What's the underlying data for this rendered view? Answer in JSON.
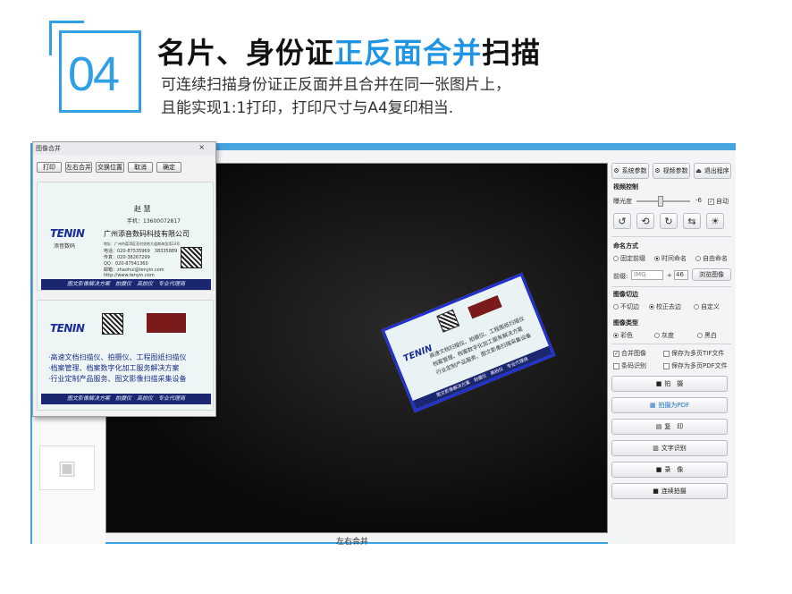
{
  "header": {
    "number": "04",
    "title_part1": "名片、身份证",
    "title_highlight": "正反面合并",
    "title_part2": "扫描",
    "subtitle_line1": "可连续扫描身份证正反面并且合并在同一张图片上，",
    "subtitle_line2": "且能实现1:1打印，打印尺寸与A4复印相当."
  },
  "popup": {
    "title": "图像合并",
    "close": "×",
    "buttons": [
      "打印",
      "左右合并",
      "交换位置",
      "取消",
      "确定"
    ]
  },
  "card_front": {
    "name": "赵 慧",
    "phone": "手机：13600072817",
    "company": "广州添音数码科技有限公司",
    "logo": "TENIN",
    "logo_sub": "添音数码",
    "address": "地址：广州市荔湾区芳村花地大道南海龙湾13号",
    "tel": "电话：020-87535969　38335889",
    "fax": "传真：020-38267299",
    "qq": "QQ：020-87541360",
    "email": "邮箱：zhaohui@tenyin.com",
    "web": "http://www.tenyin.com",
    "band": "图文影像解决方案　拍摄仪　高拍仪　专业代理商"
  },
  "card_back": {
    "logo": "TENIN",
    "line1": "·高速文档扫描仪、拍摄仪、工程图纸扫描仪",
    "line2": "·档案管理、档案数字化加工服务解决方案",
    "line3": "·行业定制产品服务、图文影像扫描采集设备",
    "band": "图文影像解决方案　拍摄仪　高拍仪　专业代理商"
  },
  "canvas_card": {
    "logo": "TENIN",
    "line1": "高速文档扫描仪、拍摄仪、工程图纸扫描仪",
    "line2": "档案管理、档案数字化加工服务解决方案",
    "line3": "行业定制产品服务、图文影像扫描采集设备",
    "band": "图文影像解决方案　拍摄仪　高拍仪　专业代理商"
  },
  "status_text": "左右合并",
  "right_panel": {
    "top_buttons": [
      "系统参数",
      "视频参数",
      "退出程序"
    ],
    "video_control": "视频控制",
    "exposure_label": "曝光度",
    "exposure_value": "-6",
    "auto_label": "自动",
    "naming_section": "命名方式",
    "naming_options": [
      "固定前缀",
      "时间命名",
      "自由命名"
    ],
    "prefix_label": "前缀:",
    "prefix_value": "IMG",
    "prefix_plus": "+",
    "prefix_number": "46",
    "browse_button": "浏览图像",
    "crop_section": "图像切边",
    "crop_options": [
      "不切边",
      "校正去边",
      "自定义"
    ],
    "type_section": "图像类型",
    "type_options": [
      "彩色",
      "灰度",
      "黑白"
    ],
    "checks": [
      "合并图像",
      "保存为多页TIF文件",
      "条码识别",
      "保存为多页PDF文件"
    ],
    "actions": [
      "拍　摄",
      "拍摄为PDF",
      "复　印",
      "文字识别",
      "录　像",
      "连续拍摄"
    ]
  },
  "colors": {
    "accent": "#1f95e3",
    "window_border": "#3fa4e4",
    "card_band": "#1b2670"
  }
}
